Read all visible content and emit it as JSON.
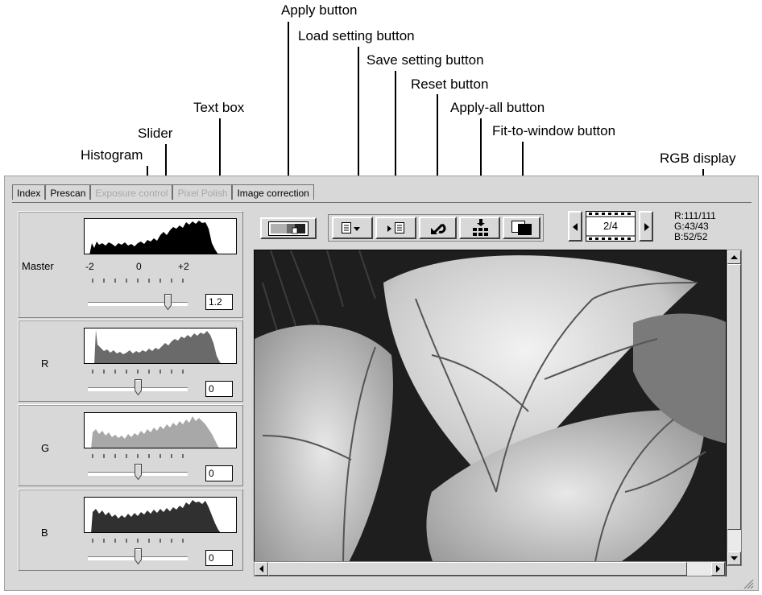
{
  "callouts": {
    "apply": "Apply button",
    "load": "Load setting button",
    "save": "Save setting button",
    "reset": "Reset button",
    "apply_all": "Apply-all button",
    "fit": "Fit-to-window button",
    "text_box": "Text box",
    "slider": "Slider",
    "histogram": "Histogram",
    "rgb_display": "RGB display"
  },
  "tabs": [
    {
      "label": "Index",
      "enabled": true
    },
    {
      "label": "Prescan",
      "enabled": true
    },
    {
      "label": "Exposure control",
      "enabled": false
    },
    {
      "label": "Pixel Polish",
      "enabled": false
    },
    {
      "label": "Image correction",
      "enabled": true
    }
  ],
  "channels": {
    "master": {
      "label": "Master",
      "value": "1.2",
      "scale_min": "-2",
      "scale_mid": "0",
      "scale_max": "+2",
      "slider_fraction": 0.8,
      "color": "#000000"
    },
    "r": {
      "label": "R",
      "value": "0",
      "slider_fraction": 0.5,
      "color": "#6a6a6a"
    },
    "g": {
      "label": "G",
      "value": "0",
      "slider_fraction": 0.5,
      "color": "#a8a8a8"
    },
    "b": {
      "label": "B",
      "value": "0",
      "slider_fraction": 0.5,
      "color": "#303030"
    }
  },
  "frame_counter": "2/4",
  "rgb": {
    "r": "R:111/111",
    "g": "G:43/43",
    "b": "B:52/52"
  },
  "icons": {
    "apply": "apply-icon",
    "load": "load-setting-icon",
    "save": "save-setting-icon",
    "reset": "reset-arrow-icon",
    "apply_all": "apply-all-icon",
    "fit": "fit-to-window-icon"
  }
}
